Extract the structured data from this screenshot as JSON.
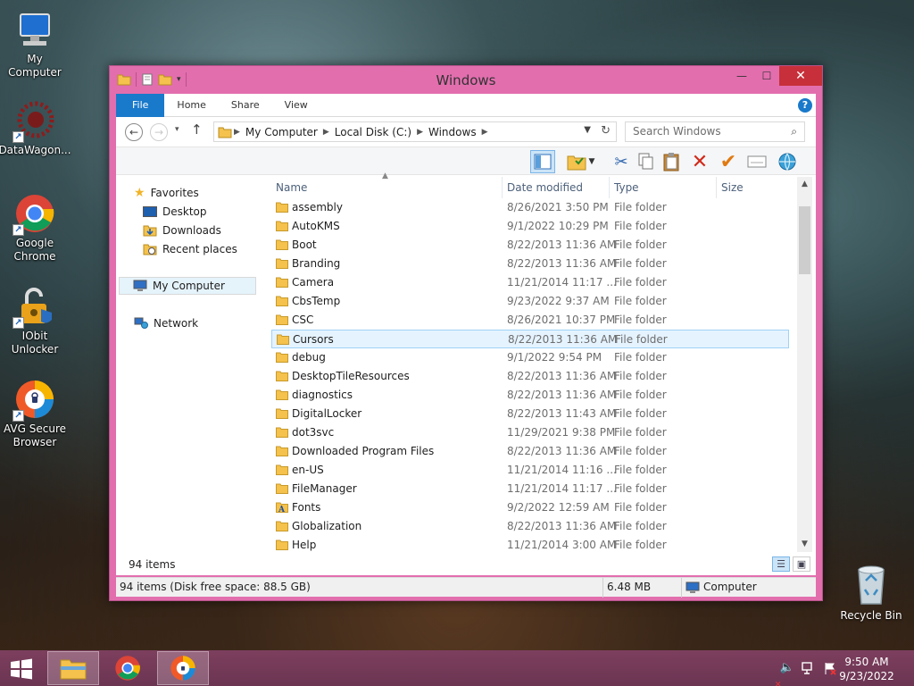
{
  "desktop": {
    "icons": [
      {
        "label": "My Computer",
        "icon": "computer-icon"
      },
      {
        "label": "DataWagon...",
        "icon": "datawagon-icon"
      },
      {
        "label": "Google Chrome",
        "icon": "chrome-icon"
      },
      {
        "label": "IObit Unlocker",
        "icon": "iobit-unlocker-icon"
      },
      {
        "label": "AVG Secure Browser",
        "icon": "avg-browser-icon"
      }
    ],
    "recycle_bin": "Recycle Bin"
  },
  "window": {
    "title": "Windows",
    "ribbon_tabs": [
      "File",
      "Home",
      "Share",
      "View"
    ],
    "help": "?",
    "address": {
      "crumbs": [
        "My Computer",
        "Local Disk (C:)",
        "Windows"
      ]
    },
    "search_placeholder": "Search Windows",
    "nav_pane": {
      "favorites": "Favorites",
      "favorites_items": [
        "Desktop",
        "Downloads",
        "Recent places"
      ],
      "computer": "My Computer",
      "network": "Network"
    },
    "columns": [
      "Name",
      "Date modified",
      "Type",
      "Size"
    ],
    "rows": [
      {
        "name": "assembly",
        "date": "8/26/2021 3:50 PM",
        "type": "File folder"
      },
      {
        "name": "AutoKMS",
        "date": "9/1/2022 10:29 PM",
        "type": "File folder"
      },
      {
        "name": "Boot",
        "date": "8/22/2013 11:36 AM",
        "type": "File folder"
      },
      {
        "name": "Branding",
        "date": "8/22/2013 11:36 AM",
        "type": "File folder"
      },
      {
        "name": "Camera",
        "date": "11/21/2014 11:17 ...",
        "type": "File folder"
      },
      {
        "name": "CbsTemp",
        "date": "9/23/2022 9:37 AM",
        "type": "File folder"
      },
      {
        "name": "CSC",
        "date": "8/26/2021 10:37 PM",
        "type": "File folder"
      },
      {
        "name": "Cursors",
        "date": "8/22/2013 11:36 AM",
        "type": "File folder",
        "selected": true
      },
      {
        "name": "debug",
        "date": "9/1/2022 9:54 PM",
        "type": "File folder"
      },
      {
        "name": "DesktopTileResources",
        "date": "8/22/2013 11:36 AM",
        "type": "File folder"
      },
      {
        "name": "diagnostics",
        "date": "8/22/2013 11:36 AM",
        "type": "File folder"
      },
      {
        "name": "DigitalLocker",
        "date": "8/22/2013 11:43 AM",
        "type": "File folder"
      },
      {
        "name": "dot3svc",
        "date": "11/29/2021 9:38 PM",
        "type": "File folder"
      },
      {
        "name": "Downloaded Program Files",
        "date": "8/22/2013 11:36 AM",
        "type": "File folder"
      },
      {
        "name": "en-US",
        "date": "11/21/2014 11:16 ...",
        "type": "File folder"
      },
      {
        "name": "FileManager",
        "date": "11/21/2014 11:17 ...",
        "type": "File folder"
      },
      {
        "name": "Fonts",
        "date": "9/2/2022 12:59 AM",
        "type": "File folder",
        "fonts": true
      },
      {
        "name": "Globalization",
        "date": "8/22/2013 11:36 AM",
        "type": "File folder"
      },
      {
        "name": "Help",
        "date": "11/21/2014 3:00 AM",
        "type": "File folder"
      }
    ],
    "item_count": "94 items",
    "status": {
      "left": "94 items (Disk free space: 88.5 GB)",
      "size": "6.48 MB",
      "location": "Computer"
    }
  },
  "taskbar": {
    "time": "9:50 AM",
    "date": "9/23/2022"
  },
  "colors": {
    "window_frame": "#e26eae",
    "accent": "#1979ca",
    "taskbar": "#6b3552",
    "folder": "#f4c24d"
  }
}
